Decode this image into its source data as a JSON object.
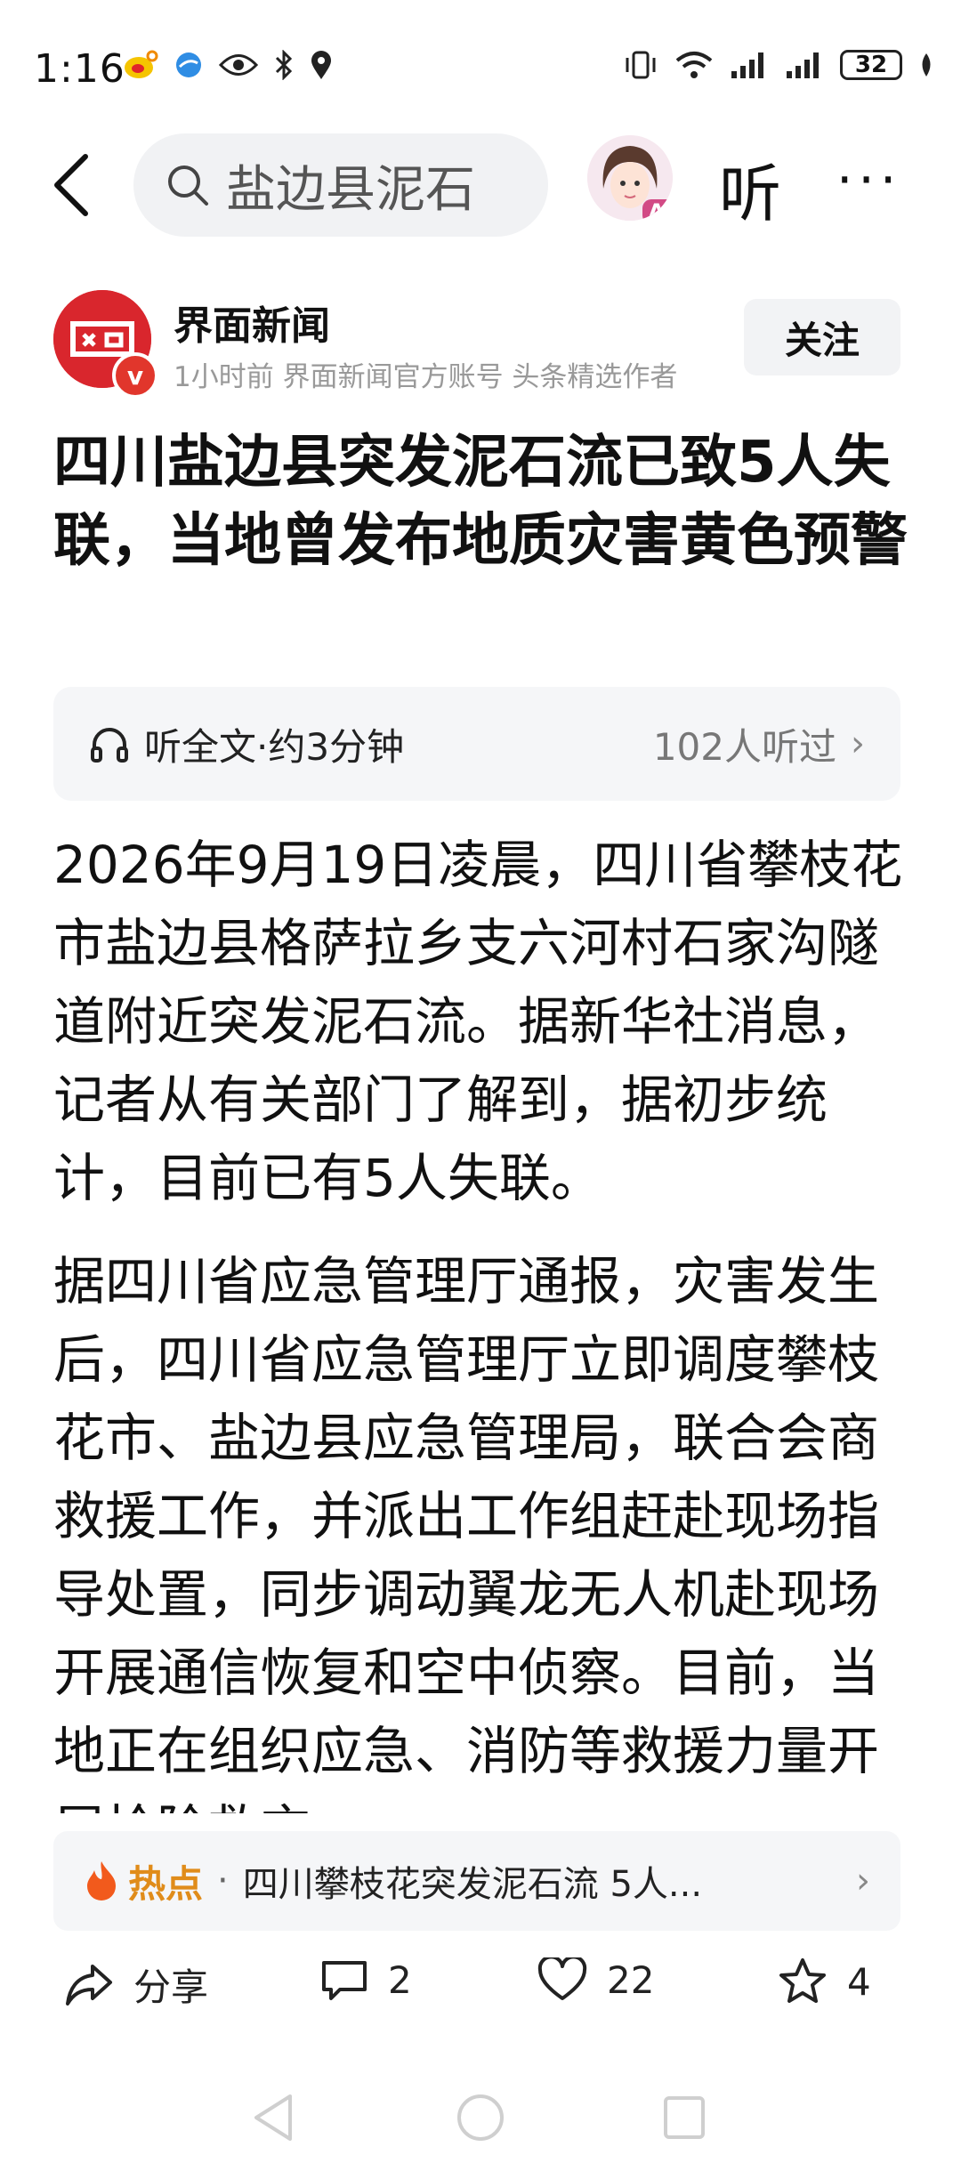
{
  "status_bar": {
    "time": "1:16",
    "battery": "32"
  },
  "top_nav": {
    "search_text": "盐边县泥石",
    "ai_badge": "AI",
    "listen_label": "听",
    "more_label": "···"
  },
  "author": {
    "name": "界面新闻",
    "meta": "1小时前  界面新闻官方账号 头条精选作者",
    "verified_mark": "v",
    "follow_label": "关注"
  },
  "article": {
    "title": "四川盐边县突发泥石流已致5人失联，当地曾发布地质灾害黄色预警",
    "listen_bar": {
      "label": "听全文·约3分钟",
      "count": "102人听过"
    },
    "paragraphs": [
      "2026年9月19日凌晨，四川省攀枝花市盐边县格萨拉乡支六河村石家沟隧道附近突发泥石流。据新华社消息，记者从有关部门了解到，据初步统计，目前已有5人失联。",
      "据四川省应急管理厅通报，灾害发生后，四川省应急管理厅立即调度攀枝花市、盐边县应急管理局，联合会商救援工作，并派出工作组赶赴现场指导处置，同步调动翼龙无人机赴现场开展通信恢复和空中侦察。目前，当地正在组织应急、消防等救援力量开展抢险救灾。"
    ]
  },
  "hot_bar": {
    "label": "热点",
    "dot": "·",
    "text": "四川攀枝花突发泥石流 5人..."
  },
  "actions": {
    "share_label": "分享",
    "comment_count": "2",
    "like_count": "22",
    "fav_count": "4"
  },
  "colors": {
    "accent_hot": "#e08c1a",
    "brand_red": "#d9262d"
  }
}
